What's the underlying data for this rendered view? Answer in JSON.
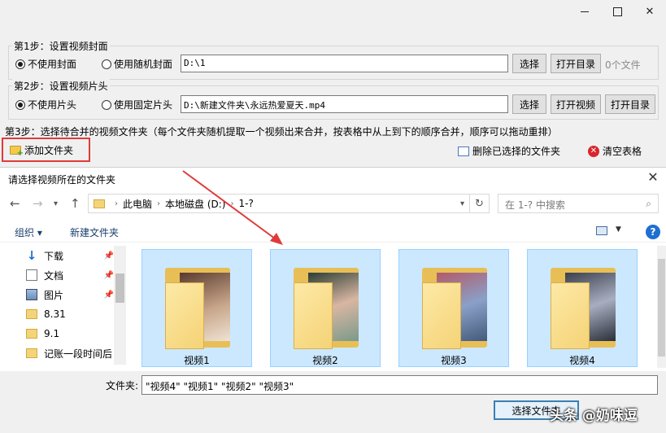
{
  "window_controls": {
    "minimize": "",
    "maximize": "",
    "close": "✕"
  },
  "step1": {
    "title": "第1步：设置视频封面",
    "radio_no": "不使用封面",
    "radio_random": "使用随机封面",
    "path": "D:\\1",
    "select": "选择",
    "open_dir": "打开目录",
    "count": "0个文件"
  },
  "step2": {
    "title": "第2步：设置视频片头",
    "radio_no": "不使用片头",
    "radio_fixed": "使用固定片头",
    "path": "D:\\新建文件夹\\永远热爱夏天.mp4",
    "select": "选择",
    "open_video": "打开视频",
    "open_dir": "打开目录"
  },
  "step3": {
    "text": "第3步：选择待合并的视频文件夹（每个文件夹随机提取一个视频出来合并，按表格中从上到下的顺序合并，顺序可以拖动重排）",
    "add_folder": "添加文件夹",
    "delete_selected": "删除已选择的文件夹",
    "clear_table": "清空表格"
  },
  "dialog": {
    "title": "请选择视频所在的文件夹",
    "close": "✕",
    "breadcrumb": [
      "此电脑",
      "本地磁盘 (D:)",
      "1-?"
    ],
    "search_placeholder": "在 1-? 中搜索",
    "organize": "组织 ▾",
    "new_folder": "新建文件夹",
    "help": "?",
    "nav_items": [
      {
        "label": "下载",
        "icon": "download-icon",
        "pinned": true
      },
      {
        "label": "文档",
        "icon": "document-icon",
        "pinned": true
      },
      {
        "label": "图片",
        "icon": "pictures-icon",
        "pinned": true
      },
      {
        "label": "8.31",
        "icon": "folder-icon",
        "pinned": false
      },
      {
        "label": "9.1",
        "icon": "folder-icon",
        "pinned": false
      },
      {
        "label": "记账一段时间后",
        "icon": "folder-icon",
        "pinned": false
      }
    ],
    "folders": [
      {
        "label": "视频1"
      },
      {
        "label": "视频2"
      },
      {
        "label": "视频3"
      },
      {
        "label": "视频4"
      }
    ],
    "filename_label": "文件夹:",
    "filename_value": "\"视频4\" \"视频1\" \"视频2\" \"视频3\"",
    "select_button": "选择文件夹"
  },
  "watermark": "头条 @奶味逗",
  "colors": {
    "highlight_border": "#e03a3a",
    "arrow": "#e03a3a",
    "tile_selected": "#cce8ff"
  }
}
